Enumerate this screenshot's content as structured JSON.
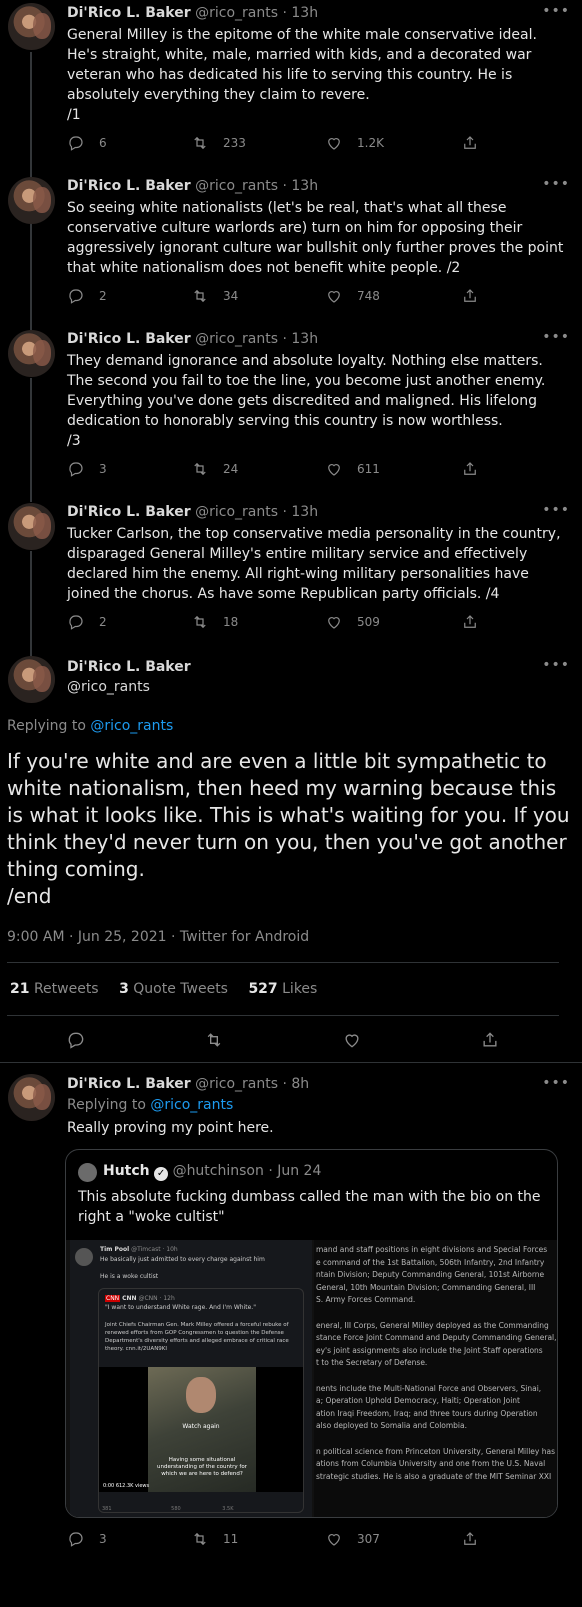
{
  "author": {
    "name": "Di'Rico L. Baker",
    "handle": "@rico_rants"
  },
  "tweets": [
    {
      "time": "13h",
      "text": "General Milley is the epitome of the white male conservative ideal. He's straight, white, male, married with kids, and a decorated war veteran who has dedicated his life to serving this country. He is absolutely everything they claim to revere.\n/1",
      "replies": "6",
      "retweets": "233",
      "likes": "1.2K"
    },
    {
      "time": "13h",
      "text": "So seeing white nationalists (let's be real, that's what all these conservative culture warlords are) turn on him for opposing their aggressively ignorant culture war bullshit only further proves the point that white nationalism does not benefit white people. /2",
      "replies": "2",
      "retweets": "34",
      "likes": "748"
    },
    {
      "time": "13h",
      "text": "They demand ignorance and absolute loyalty. Nothing else matters. The second you fail to toe the line, you become just another enemy. Everything you've done gets discredited and maligned. His lifelong dedication to honorably serving this country is now worthless.\n/3",
      "replies": "3",
      "retweets": "24",
      "likes": "611"
    },
    {
      "time": "13h",
      "text": "Tucker Carlson, the top conservative media personality in the country, disparaged General Milley's entire military service and effectively declared him the enemy. All right-wing military personalities have joined the chorus. As have some Republican party officials. /4",
      "replies": "2",
      "retweets": "18",
      "likes": "509"
    }
  ],
  "main_tweet": {
    "replying_label": "Replying to",
    "replying_to": "@rico_rants",
    "text": "If you're white and are even a little bit sympathetic to white nationalism, then heed my warning because this is what it looks like. This is what's waiting for you. If you think they'd never turn on you, then you've got another thing coming.\n/end",
    "meta": "9:00 AM · Jun 25, 2021 · Twitter for Android",
    "retweets_count": "21",
    "retweets_label": "Retweets",
    "quotes_count": "3",
    "quotes_label": "Quote Tweets",
    "likes_count": "527",
    "likes_label": "Likes"
  },
  "reply_tweet": {
    "time": "8h",
    "replying_label": "Replying to",
    "replying_to": "@rico_rants",
    "text": "Really proving my point here.",
    "replies": "3",
    "retweets": "11",
    "likes": "307",
    "quoted": {
      "name": "Hutch",
      "handle": "@hutchinson",
      "time": "Jun 24",
      "text": "This absolute fucking dumbass called the man with the bio on the right a \"woke cultist\"",
      "embedded": {
        "tp_name": "Tim Pool",
        "tp_handle": "@Timcast · 10h",
        "tp_line1": "He basically just admitted to every charge against him",
        "tp_line2": "He is a woke cultist",
        "cnn_name": "CNN",
        "cnn_handle": "@CNN · 12h",
        "cnn_quote": "\"I want to understand White rage. And I'm White.\"",
        "cnn_body": "Joint Chiefs Chairman Gen. Mark Milley offered a forceful rebuke of renewed efforts from GOP Congressmen to question the Defense Department's diversity efforts and alleged embrace of critical race theory. cnn.it/2UAN9KI",
        "video_label": "Watch again",
        "caption": "Having some situational understanding of the country for which we are here to defend?",
        "views": "0:00  612.3K views",
        "stats": [
          "381",
          "580",
          "3.5K"
        ],
        "bio": [
          "mand and staff positions in eight divisions and Special Forces",
          "e command of the 1st Battalion, 506th Infantry, 2nd Infantry",
          "ntain Division; Deputy Commanding General, 101st Airborne",
          "General, 10th Mountain Division; Commanding General, III",
          "S. Army Forces Command.",
          "",
          "eneral, III Corps, General Milley deployed as the Commanding",
          "stance Force Joint Command and Deputy Commanding General,",
          "ey's joint assignments also include the Joint Staff operations",
          "t to the Secretary of Defense.",
          "",
          "nents include the Multi-National Force and Observers, Sinai,",
          "a; Operation Uphold Democracy, Haiti; Operation Joint",
          "ation Iraqi Freedom, Iraq; and three tours during Operation",
          "also deployed to Somalia and Colombia.",
          "",
          "n political science from Princeton University, General Milley has",
          "ations from Columbia University and one from the U.S. Naval",
          "strategic studies. He is also a graduate of the MIT Seminar XXI"
        ]
      }
    }
  },
  "colors": {
    "background": "#000000",
    "accent": "#1d9bf0",
    "text": "#d9d9d9",
    "muted": "#8b8b8b"
  },
  "icons": [
    "reply-icon",
    "retweet-icon",
    "like-icon",
    "share-icon",
    "more-icon",
    "verified-icon"
  ]
}
